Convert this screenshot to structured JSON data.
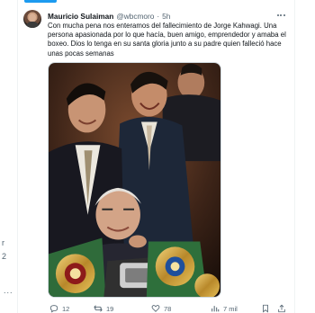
{
  "tweet": {
    "author": {
      "display_name": "Mauricio Sulaiman",
      "handle": "@wbcmoro",
      "separator": "·",
      "time": "5h",
      "avatar_icon": "profile-photo"
    },
    "text": "Con mucha pena nos enteramos del fallecimiento de Jorge Kahwagi. Una persona apasionada por lo que hacía, buen amigo, emprendedor y amaba el boxeo. Dios lo tenga en su santa gloria junto a su padre quien falleció hace unas pocas semanas",
    "media": {
      "kind": "photo",
      "description_icon": "group-photo-with-championship-belts"
    },
    "actions": {
      "replies": "12",
      "reposts": "19",
      "likes": "78",
      "views": "7 mil"
    },
    "icons": {
      "more": "more-horizontal-icon",
      "reply": "reply-icon",
      "repost": "repost-icon",
      "like": "heart-icon",
      "views": "views-icon",
      "bookmark": "bookmark-icon",
      "share": "share-icon"
    }
  },
  "colors": {
    "accent": "#1d9bf0",
    "text_primary": "#0f1419",
    "text_secondary": "#536471",
    "border": "#cfd9de"
  },
  "gutter": {
    "marks": [
      "r",
      "2",
      "..."
    ]
  }
}
